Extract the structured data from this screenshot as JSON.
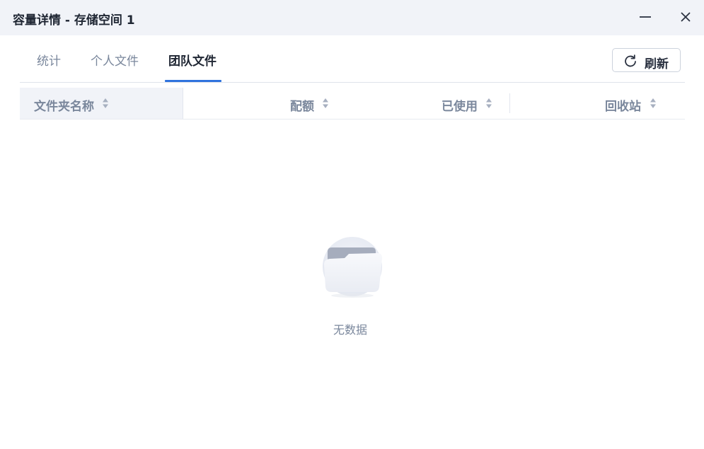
{
  "window": {
    "title": "容量详情 - 存储空间 1"
  },
  "tabs": [
    {
      "label": "统计",
      "active": false
    },
    {
      "label": "个人文件",
      "active": false
    },
    {
      "label": "团队文件",
      "active": true
    }
  ],
  "toolbar": {
    "refresh_label": "刷新",
    "refresh_icon": "refresh-icon"
  },
  "table": {
    "columns": [
      {
        "label": "文件夹名称",
        "sortable": true
      },
      {
        "label": "配额",
        "sortable": true
      },
      {
        "label": "已使用",
        "sortable": true
      },
      {
        "label": "回收站",
        "sortable": true
      }
    ],
    "rows": [],
    "empty_text": "无数据"
  },
  "colors": {
    "accent": "#2f73dd",
    "titlebar_bg": "#f1f3f8",
    "muted_text": "#7a879c",
    "primary_text": "#1f2633"
  }
}
